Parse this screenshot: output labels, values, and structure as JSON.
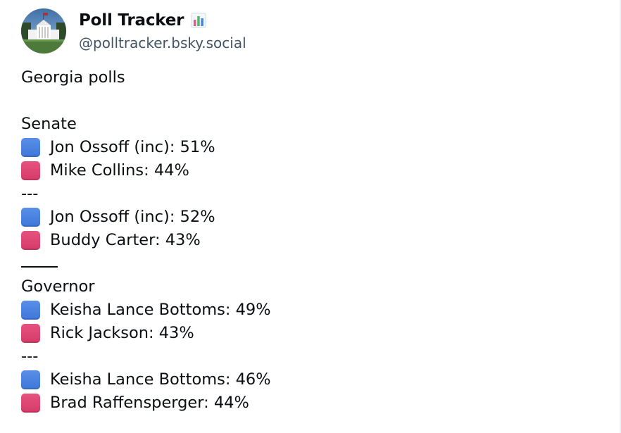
{
  "author": {
    "display_name": "Poll Tracker",
    "handle": "@polltracker.bsky.social",
    "avatar_icon": "white-house-avatar",
    "name_emoji_icon": "bar-chart-icon"
  },
  "post": {
    "lines": [
      {
        "type": "text",
        "text": "Georgia polls"
      },
      {
        "type": "blank"
      },
      {
        "type": "text",
        "text": "Senate"
      },
      {
        "type": "candidate",
        "party": "blue",
        "text": "Jon Ossoff (inc): 51%"
      },
      {
        "type": "candidate",
        "party": "red",
        "text": "Mike Collins: 44%"
      },
      {
        "type": "text",
        "text": "---"
      },
      {
        "type": "candidate",
        "party": "blue",
        "text": "Jon Ossoff (inc): 52%"
      },
      {
        "type": "candidate",
        "party": "red",
        "text": "Buddy Carter: 43%"
      },
      {
        "type": "rule"
      },
      {
        "type": "text",
        "text": "Governor"
      },
      {
        "type": "candidate",
        "party": "blue",
        "text": "Keisha Lance Bottoms: 49%"
      },
      {
        "type": "candidate",
        "party": "red",
        "text": "Rick Jackson: 43%"
      },
      {
        "type": "text",
        "text": "---"
      },
      {
        "type": "candidate",
        "party": "blue",
        "text": "Keisha Lance Bottoms: 46%"
      },
      {
        "type": "candidate",
        "party": "red",
        "text": "Brad Raffensperger: 44%"
      }
    ]
  },
  "colors": {
    "blue_square": "#4a82e0",
    "red_square": "#dd4572",
    "text": "#0b0f14",
    "handle": "#425466"
  }
}
